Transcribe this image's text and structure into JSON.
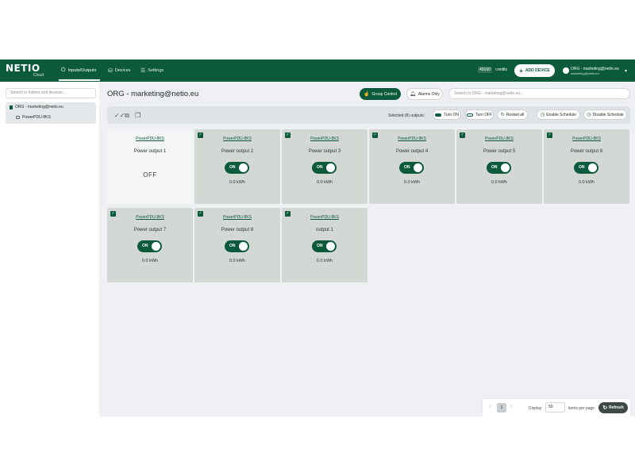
{
  "brand": {
    "logo": "NETIO",
    "sub": "Cloud"
  },
  "nav": [
    {
      "label": "Inputs/Outputs",
      "icon": "power-icon"
    },
    {
      "label": "Devices",
      "icon": "devices-icon"
    },
    {
      "label": "Settings",
      "icon": "sliders-icon"
    }
  ],
  "header": {
    "credits_value": "49160",
    "credits_label": "credits",
    "add_device": "ADD DEVICE",
    "user_name": "ORG - marketing@netio.eu",
    "user_email": "marketing@netio.eu"
  },
  "sidebar": {
    "search_placeholder": "Search in folders and devices...",
    "org_label": "ORG - marketing@netio.eu",
    "device_label": "PowerPDU-8KS"
  },
  "main": {
    "title": "ORG - marketing@netio.eu",
    "group_control": "Group Control",
    "alarms_only": "Alarms Only",
    "search_placeholder": "Search in ORG - marketing@netio.eu..."
  },
  "toolbar": {
    "selected_label": "Selected (8) outputs:",
    "turn_on": "Turn ON",
    "turn_off": "Turn OFF",
    "restart_all": "Restart all",
    "enable_schedule": "Enable Schedule",
    "disable_schedule": "Disable Schedule"
  },
  "outputs": [
    {
      "device": "PowerPDU-8KS",
      "name": "Power output 1",
      "state": "OFF",
      "energy": "",
      "selected": false
    },
    {
      "device": "PowerPDU-8KS",
      "name": "Power output 2",
      "state": "ON",
      "energy": "0.0 kWh",
      "selected": true
    },
    {
      "device": "PowerPDU-8KS",
      "name": "Power output 3",
      "state": "ON",
      "energy": "0.0 kWh",
      "selected": true
    },
    {
      "device": "PowerPDU-8KS",
      "name": "Power output 4",
      "state": "ON",
      "energy": "0.0 kWh",
      "selected": true
    },
    {
      "device": "PowerPDU-8KS",
      "name": "Power output 5",
      "state": "ON",
      "energy": "0.0 kWh",
      "selected": true
    },
    {
      "device": "PowerPDU-8KS",
      "name": "Power output 6",
      "state": "ON",
      "energy": "0.0 kWh",
      "selected": true
    },
    {
      "device": "PowerPDU-8KS",
      "name": "Power output 7",
      "state": "ON",
      "energy": "0.0 kWh",
      "selected": true
    },
    {
      "device": "PowerPDU-8KS",
      "name": "Power output 8",
      "state": "ON",
      "energy": "0.0 kWh",
      "selected": true
    },
    {
      "device": "PowerPDU-8KS",
      "name": "output 1",
      "state": "ON",
      "energy": "0.0 kWh",
      "selected": true
    }
  ],
  "pager": {
    "page": "1",
    "display_label": "Display",
    "display_value": "50",
    "items_per_page": "items per page",
    "refresh": "Refresh"
  },
  "colors": {
    "brand": "#0b5a3c",
    "card": "#d3d8d5",
    "background": "#eef0f3"
  }
}
